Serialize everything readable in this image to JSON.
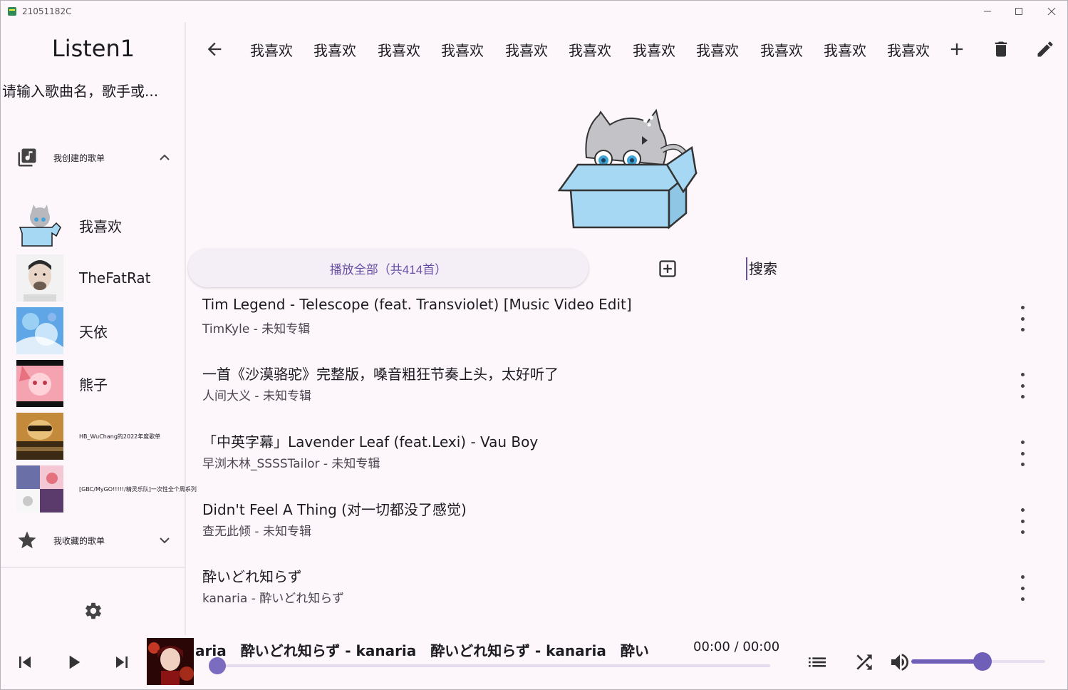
{
  "window": {
    "title": "21051182C"
  },
  "sidebar": {
    "brand": "Listen1",
    "search_placeholder": "请输入歌曲名，歌手或...",
    "created_section": {
      "label": "我创建的歌单"
    },
    "playlists": [
      {
        "name": "我喜欢"
      },
      {
        "name": "TheFatRat"
      },
      {
        "name": "天依"
      },
      {
        "name": "熊子"
      },
      {
        "name": "HB_WuChang的2022年度歌单"
      },
      {
        "name": "[GBC/MyGO!!!!!/精灵乐队]一次性全个周系列"
      }
    ],
    "favorite_section": {
      "label": "我收藏的歌单"
    }
  },
  "topbar": {
    "tabs": [
      "我喜欢",
      "我喜欢",
      "我喜欢",
      "我喜欢",
      "我喜欢",
      "我喜欢",
      "我喜欢",
      "我喜欢",
      "我喜欢",
      "我喜欢",
      "我喜欢"
    ]
  },
  "actions": {
    "play_all_label": "播放全部（共414首）",
    "search_placeholder": "搜索"
  },
  "songs": [
    {
      "title": "Tim Legend - Telescope (feat. Transviolet) [Music Video Edit]",
      "subtitle": "TimKyle - 未知专辑"
    },
    {
      "title": "一首《沙漠骆驼》完整版，嗓音粗狂节奏上头，太好听了",
      "subtitle": "人间大义 - 未知专辑"
    },
    {
      "title": "「中英字幕」Lavender Leaf (feat.Lexi) - Vau Boy",
      "subtitle": "早浏木林_SSSSTailor - 未知专辑"
    },
    {
      "title": "Didn't Feel A Thing (对一切都没了感觉)",
      "subtitle": "查无此倾 - 未知专辑"
    },
    {
      "title": "酔いどれ知らず",
      "subtitle": "kanaria - 酔いどれ知らず"
    }
  ],
  "player": {
    "marquee": "aria　酔いどれ知らず - kanaria　酔いどれ知らず - kanaria　酔い",
    "time": "00:00 / 00:00",
    "progress": 0,
    "volume": 0.53
  },
  "colors": {
    "accent": "#6750a4",
    "background": "#fdf7fc"
  }
}
